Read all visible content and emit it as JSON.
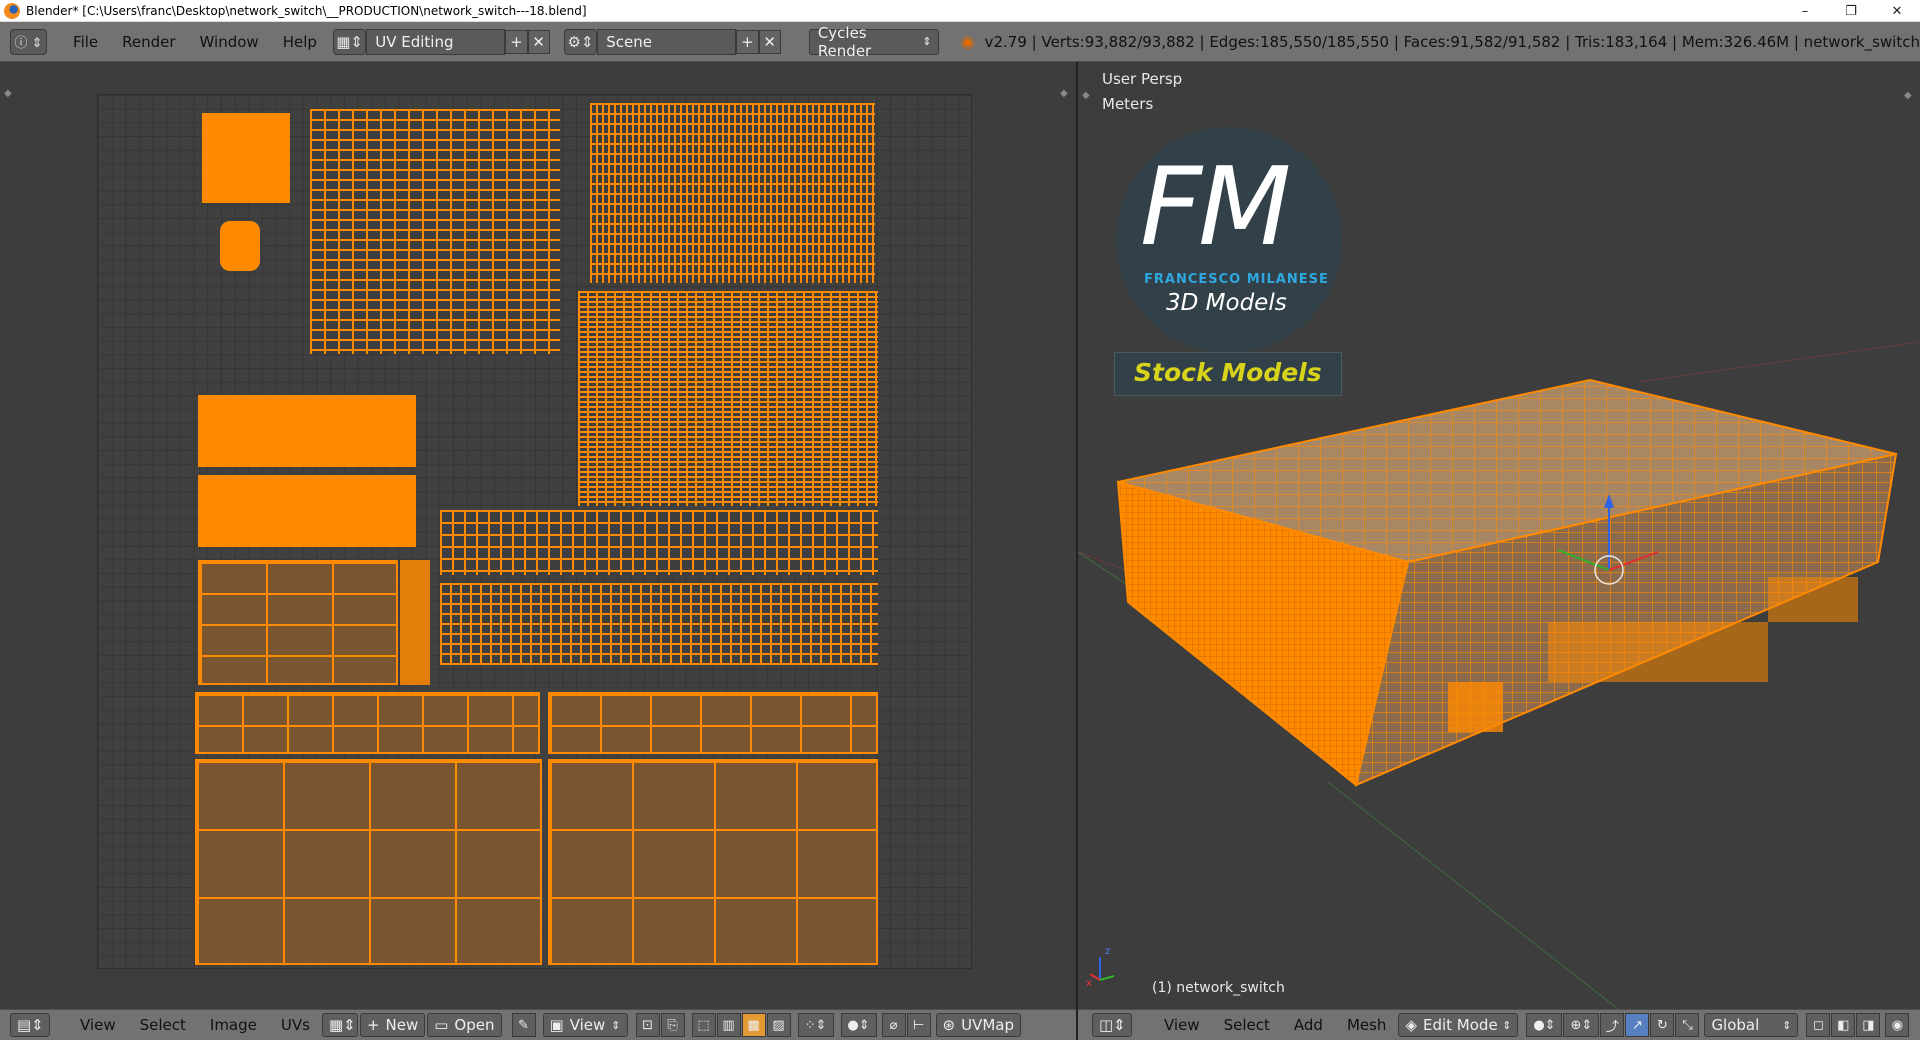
{
  "window": {
    "title": "Blender* [C:\\Users\\franc\\Desktop\\network_switch\\__PRODUCTION\\network_switch---18.blend]",
    "minimize": "–",
    "maximize": "❐",
    "close": "✕"
  },
  "header": {
    "menus": [
      "File",
      "Render",
      "Window",
      "Help"
    ],
    "screen_layout": "UV Editing",
    "scene": "Scene",
    "render_engine": "Cycles Render",
    "stats": "v2.79 | Verts:93,882/93,882 | Edges:185,550/185,550 | Faces:91,582/91,582 | Tris:183,164 | Mem:326.46M | network_switch"
  },
  "viewport": {
    "view_name": "User Persp",
    "units": "Meters",
    "object_label": "(1) network_switch",
    "axis_x": "x",
    "axis_z": "z"
  },
  "logo": {
    "letters": "FM",
    "name": "FRANCESCO MILANESE",
    "sub": "3D Models",
    "tag": "Stock Models"
  },
  "uv_toolbar": {
    "menus": [
      "View",
      "Select",
      "Image",
      "UVs"
    ],
    "new_label": "New",
    "open_label": "Open",
    "view_label": "View",
    "uvmap_label": "UVMap"
  },
  "vp_toolbar": {
    "menus": [
      "View",
      "Select",
      "Add",
      "Mesh"
    ],
    "mode": "Edit Mode",
    "orientation": "Global"
  },
  "colors": {
    "accent": "#ff8a00",
    "bar": "#727272",
    "background": "#3d3d3d",
    "logo_text": "#d7d21a",
    "logo_blue": "#2fa8e0"
  }
}
